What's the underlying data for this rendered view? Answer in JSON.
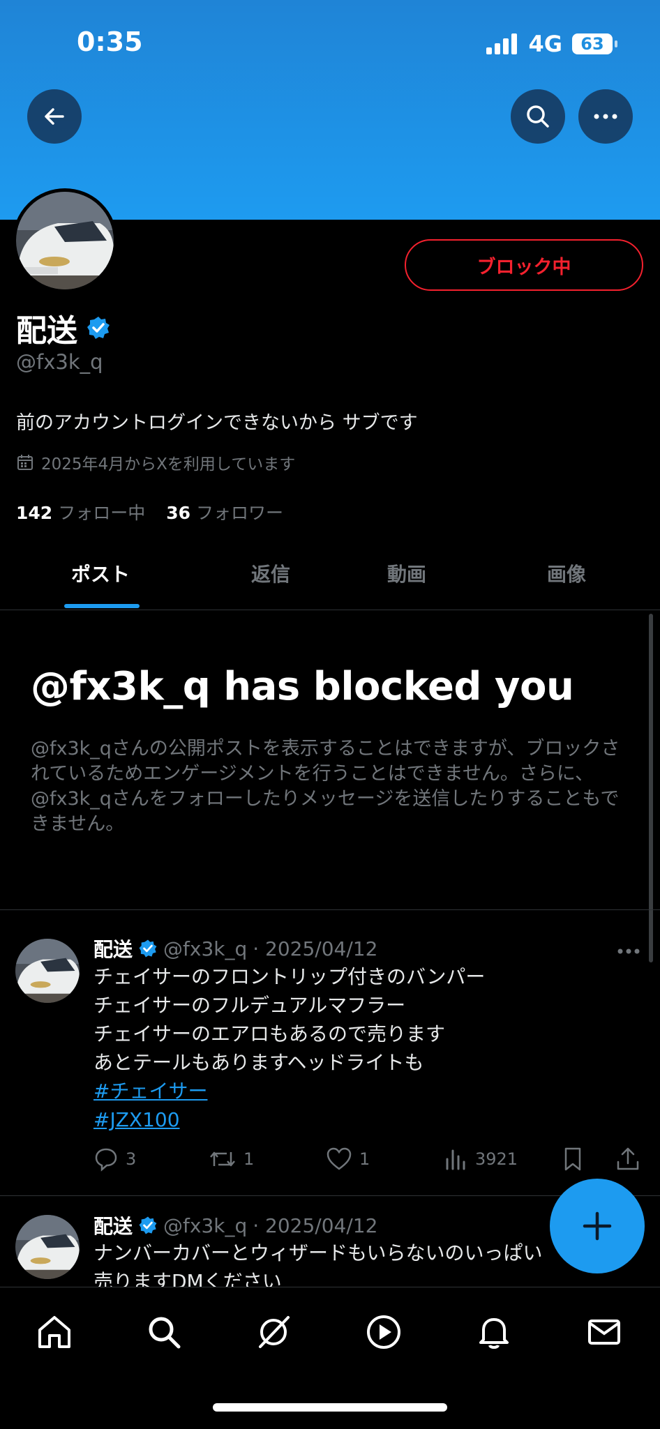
{
  "status": {
    "time": "0:35",
    "network": "4G",
    "battery": "63"
  },
  "profile": {
    "name": "配送",
    "handle": "@fx3k_q",
    "block_button": "ブロック中",
    "bio": "前のアカウントログインできないから サブです",
    "joined": "2025年4月からXを利用しています",
    "following_count": "142",
    "following_label": "フォロー中",
    "followers_count": "36",
    "followers_label": "フォロワー"
  },
  "tabs": [
    {
      "label": "ポスト"
    },
    {
      "label": "返信"
    },
    {
      "label": "動画"
    },
    {
      "label": "画像"
    }
  ],
  "blocked": {
    "title": "@fx3k_q has blocked you",
    "description": "@fx3k_qさんの公開ポストを表示することはできますが、ブロックされているためエンゲージメントを行うことはできません。さらに、@fx3k_qさんをフォローしたりメッセージを送信したりすることもできません。"
  },
  "posts": [
    {
      "name": "配送",
      "handle": "@fx3k_q",
      "date": "· 2025/04/12",
      "lines": [
        "チェイサーのフロントリップ付きのバンパー",
        "チェイサーのフルデュアルマフラー",
        "チェイサーのエアロもあるので売ります",
        "あとテールもありますヘッドライトも"
      ],
      "hashtags": [
        "#チェイサー",
        "#JZX100"
      ],
      "replies": "3",
      "reposts": "1",
      "likes": "1",
      "views": "3921"
    },
    {
      "name": "配送",
      "handle": "@fx3k_q",
      "date": "· 2025/04/12",
      "lines": [
        "ナンバーカバーとウィザードもいらないのいっぱい",
        "売りますDMください"
      ]
    }
  ]
}
